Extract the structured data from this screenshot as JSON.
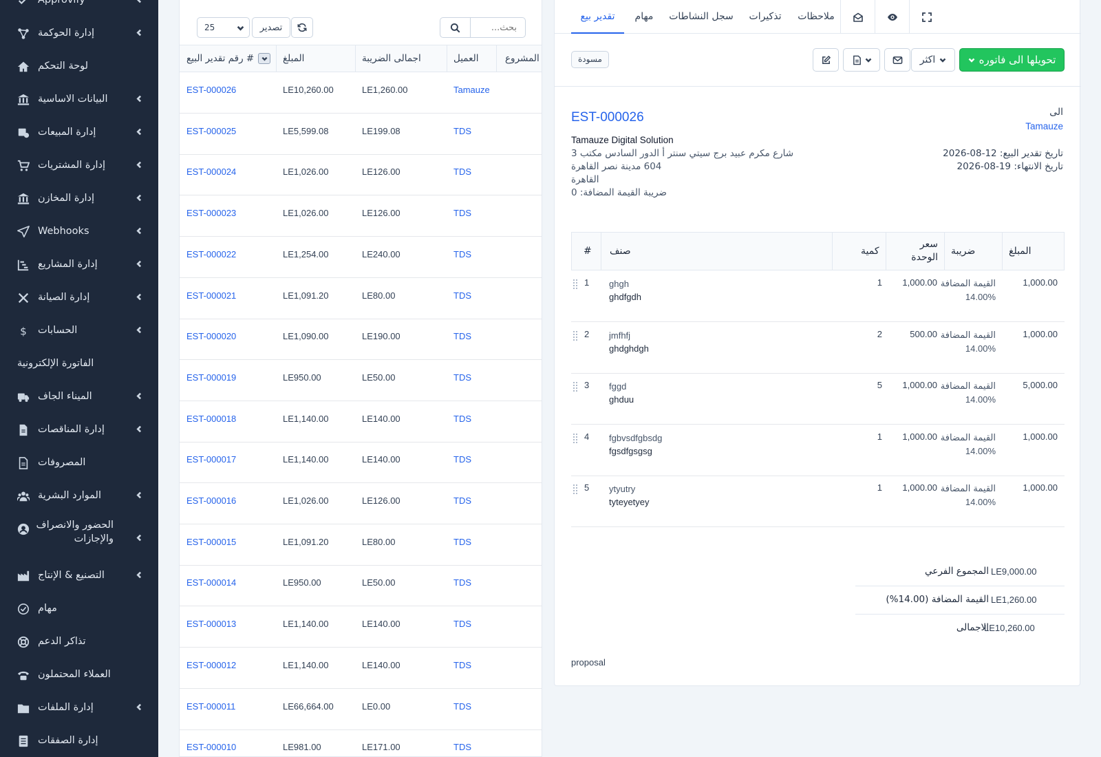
{
  "sidebar": {
    "items": [
      {
        "label": "Approvify",
        "has_children": true,
        "icon": "check-icon"
      },
      {
        "label": "إدارة الحوكمة",
        "has_children": true,
        "icon": "diagram-icon"
      },
      {
        "label": "لوحة التحكم",
        "has_children": false,
        "icon": "home-icon"
      },
      {
        "label": "البيانات الاساسية",
        "has_children": true,
        "icon": "bank-icon"
      },
      {
        "label": "إدارة المبيعات",
        "has_children": true,
        "icon": "receipt-icon"
      },
      {
        "label": "إدارة المشتريات",
        "has_children": true,
        "icon": "cart-icon"
      },
      {
        "label": "إدارة المخازن",
        "has_children": true,
        "icon": "warehouse-icon"
      },
      {
        "label": "Webhooks",
        "has_children": true,
        "icon": "send-icon"
      },
      {
        "label": "إدارة المشاريع",
        "has_children": true,
        "icon": "chart-steps-icon"
      },
      {
        "label": "إدارة الصيانة",
        "has_children": true,
        "icon": "tools-icon"
      },
      {
        "label": "الحسابات",
        "has_children": true,
        "icon": "dollar-icon"
      },
      {
        "label": "الفاتورة الإلكترونية",
        "has_children": false,
        "icon": "none"
      },
      {
        "label": "الميناء الجاف",
        "has_children": true,
        "icon": "truck-icon"
      },
      {
        "label": "إدارة المناقصات",
        "has_children": true,
        "icon": "file-icon"
      },
      {
        "label": "المصروفات",
        "has_children": false,
        "icon": "document-icon"
      },
      {
        "label": "الموارد البشرية",
        "has_children": true,
        "icon": "users-icon"
      },
      {
        "label": "الحضور والانصراف والإجازات",
        "has_children": true,
        "icon": "user-circle-icon"
      },
      {
        "label": "التصنيع & الإنتاج",
        "has_children": true,
        "icon": "factory-icon"
      },
      {
        "label": "مهام",
        "has_children": false,
        "icon": "check-circle-icon"
      },
      {
        "label": "تذاكر الدعم",
        "has_children": false,
        "icon": "lifebuoy-icon"
      },
      {
        "label": "العملاء المحتملون",
        "has_children": false,
        "icon": "phone-icon"
      },
      {
        "label": "إدارة الملفات",
        "has_children": true,
        "icon": "folder-icon"
      },
      {
        "label": "إدارة الصفقات",
        "has_children": false,
        "icon": "ledger-icon"
      }
    ]
  },
  "list": {
    "page_size": "25",
    "export_label": "تصدير",
    "search_placeholder": "بحث...",
    "columns": [
      "# رقم تقدير البيع",
      "المبلغ",
      "اجمالى الضريبة",
      "العميل",
      "المشروع"
    ],
    "rows": [
      {
        "number": "EST-000026",
        "amount": "LE10,260.00",
        "tax": "LE1,260.00",
        "client": "Tamauze"
      },
      {
        "number": "EST-000025",
        "amount": "LE5,599.08",
        "tax": "LE199.08",
        "client": "TDS"
      },
      {
        "number": "EST-000024",
        "amount": "LE1,026.00",
        "tax": "LE126.00",
        "client": "TDS"
      },
      {
        "number": "EST-000023",
        "amount": "LE1,026.00",
        "tax": "LE126.00",
        "client": "TDS"
      },
      {
        "number": "EST-000022",
        "amount": "LE1,254.00",
        "tax": "LE240.00",
        "client": "TDS"
      },
      {
        "number": "EST-000021",
        "amount": "LE1,091.20",
        "tax": "LE80.00",
        "client": "TDS"
      },
      {
        "number": "EST-000020",
        "amount": "LE1,090.00",
        "tax": "LE190.00",
        "client": "TDS"
      },
      {
        "number": "EST-000019",
        "amount": "LE950.00",
        "tax": "LE50.00",
        "client": "TDS"
      },
      {
        "number": "EST-000018",
        "amount": "LE1,140.00",
        "tax": "LE140.00",
        "client": "TDS"
      },
      {
        "number": "EST-000017",
        "amount": "LE1,140.00",
        "tax": "LE140.00",
        "client": "TDS"
      },
      {
        "number": "EST-000016",
        "amount": "LE1,026.00",
        "tax": "LE126.00",
        "client": "TDS"
      },
      {
        "number": "EST-000015",
        "amount": "LE1,091.20",
        "tax": "LE80.00",
        "client": "TDS"
      },
      {
        "number": "EST-000014",
        "amount": "LE950.00",
        "tax": "LE50.00",
        "client": "TDS"
      },
      {
        "number": "EST-000013",
        "amount": "LE1,140.00",
        "tax": "LE140.00",
        "client": "TDS"
      },
      {
        "number": "EST-000012",
        "amount": "LE1,140.00",
        "tax": "LE140.00",
        "client": "TDS"
      },
      {
        "number": "EST-000011",
        "amount": "LE66,664.00",
        "tax": "LE0.00",
        "client": "TDS"
      },
      {
        "number": "EST-000010",
        "amount": "LE981.00",
        "tax": "LE171.00",
        "client": "TDS"
      }
    ]
  },
  "detail": {
    "tabs": [
      "تقدير بيع",
      "مهام",
      "سجل النشاطات",
      "تذكيرات",
      "ملاحظات"
    ],
    "status_badge": "مسودة",
    "convert_label": "تحويلها الى فاتوره",
    "more_label": "اكثر",
    "estimate_number": "EST-000026",
    "to_label": "الى",
    "to_client": "Tamauze",
    "company_name": "Tamauze Digital Solution",
    "address_lines": [
      "شارع مكرم عبيد برج سيتي سنتر أ الدور السادس مكتب 3",
      "604 مدينة نصر القاهرة",
      "القاهرة",
      "ضريبة القيمة المضافة: 0"
    ],
    "estimate_date": "تاريخ تقدير البيع: 12-08-2026",
    "expiry_date": "تاريخ الانتهاء: 19-08-2026",
    "items_columns": [
      "#",
      "صنف",
      "كمية",
      "سعر الوحدة",
      "ضريبة",
      "المبلغ"
    ],
    "items": [
      {
        "num": "1",
        "name": "ghgh",
        "desc": "ghdfgdh",
        "qty": "1",
        "price": "1,000.00",
        "tax_name": "القيمة المضافة",
        "tax_rate": "14.00%",
        "amount": "1,000.00"
      },
      {
        "num": "2",
        "name": "jmfhfj",
        "desc": "ghdghdgh",
        "qty": "2",
        "price": "500.00",
        "tax_name": "القيمة المضافة",
        "tax_rate": "14.00%",
        "amount": "1,000.00"
      },
      {
        "num": "3",
        "name": "fggd",
        "desc": "ghduu",
        "qty": "5",
        "price": "1,000.00",
        "tax_name": "القيمة المضافة",
        "tax_rate": "14.00%",
        "amount": "5,000.00"
      },
      {
        "num": "4",
        "name": "fgbvsdfgbsdg",
        "desc": "fgsdfgsgsg",
        "qty": "1",
        "price": "1,000.00",
        "tax_name": "القيمة المضافة",
        "tax_rate": "14.00%",
        "amount": "1,000.00"
      },
      {
        "num": "5",
        "name": "ytyutry",
        "desc": "tyteyetyey",
        "qty": "1",
        "price": "1,000.00",
        "tax_name": "القيمة المضافة",
        "tax_rate": "14.00%",
        "amount": "1,000.00"
      }
    ],
    "totals": [
      {
        "label": "المجموع الفرعي",
        "value": "LE9,000.00"
      },
      {
        "label": "القيمة المضافة (14.00%)",
        "value": "LE1,260.00"
      },
      {
        "label": "الاجمالى",
        "value": "LE10,260.00"
      }
    ],
    "note": "proposal"
  },
  "colors": {
    "sidebar_bg": "#1e293b",
    "primary": "#2563eb",
    "success": "#22c55e"
  }
}
